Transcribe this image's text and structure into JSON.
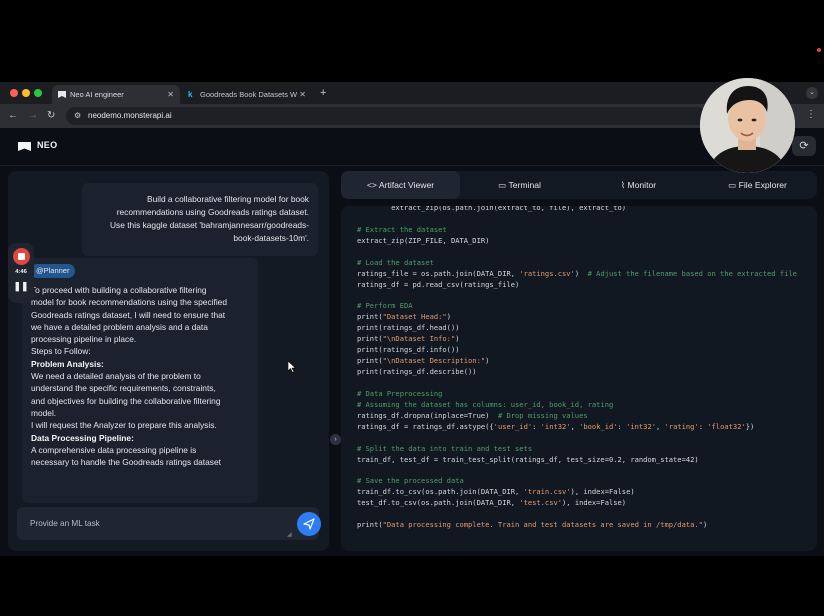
{
  "browser": {
    "tabs": [
      {
        "title": "Neo AI engineer",
        "active": true
      },
      {
        "title": "Goodreads Book Datasets W",
        "active": false
      }
    ],
    "url": "neodemo.monsterapi.ai"
  },
  "app": {
    "name": "NEO",
    "right_tabs": [
      {
        "label": "Artifact Viewer",
        "icon": "code-icon"
      },
      {
        "label": "Terminal",
        "icon": "terminal-icon"
      },
      {
        "label": "Monitor",
        "icon": "monitor-icon"
      },
      {
        "label": "File Explorer",
        "icon": "folder-icon"
      }
    ]
  },
  "recording": {
    "time": "4:46"
  },
  "chat": {
    "user_message": [
      "Build a collaborative filtering model for book",
      "recommendations using Goodreads ratings dataset.",
      "Use this kaggle dataset 'bahramjannesarr/goodreads-",
      "book-datasets-10m'."
    ],
    "agent_badge": "@Planner",
    "agent_lines": [
      {
        "text": "To proceed with building a collaborative filtering",
        "bold": false
      },
      {
        "text": "model for book recommendations using the specified",
        "bold": false
      },
      {
        "text": "Goodreads ratings dataset, I will need to ensure that",
        "bold": false
      },
      {
        "text": "we have a detailed problem analysis and a data",
        "bold": false
      },
      {
        "text": "processing pipeline in place.",
        "bold": false
      },
      {
        "text": "Steps to Follow:",
        "bold": false
      },
      {
        "text": "Problem Analysis:",
        "bold": true
      },
      {
        "text": "We need a detailed analysis of the problem to",
        "bold": false
      },
      {
        "text": "understand the specific requirements, constraints,",
        "bold": false
      },
      {
        "text": "and objectives for building the collaborative filtering",
        "bold": false
      },
      {
        "text": "model.",
        "bold": false
      },
      {
        "text": "I will request the Analyzer to prepare this analysis.",
        "bold": false
      },
      {
        "text": "Data Processing Pipeline:",
        "bold": true
      },
      {
        "text": "A comprehensive data processing pipeline is",
        "bold": false
      },
      {
        "text": "necessary to handle the Goodreads ratings dataset",
        "bold": false
      }
    ],
    "input_placeholder": "Provide an ML task"
  },
  "code_lines": [
    "        extract_zip(os.path.join(extract_to, file), extract_to)",
    "",
    "# Extract the dataset",
    "extract_zip(ZIP_FILE, DATA_DIR)",
    "",
    "# Load the dataset",
    "ratings_file = os.path.join(DATA_DIR, 'ratings.csv')  # Adjust the filename based on the extracted file",
    "ratings_df = pd.read_csv(ratings_file)",
    "",
    "# Perform EDA",
    "print(\"Dataset Head:\")",
    "print(ratings_df.head())",
    "print(\"\\nDataset Info:\")",
    "print(ratings_df.info())",
    "print(\"\\nDataset Description:\")",
    "print(ratings_df.describe())",
    "",
    "# Data Preprocessing",
    "# Assuming the dataset has columns: user_id, book_id, rating",
    "ratings_df.dropna(inplace=True)  # Drop missing values",
    "ratings_df = ratings_df.astype({'user_id': 'int32', 'book_id': 'int32', 'rating': 'float32'})",
    "",
    "# Split the data into train and test sets",
    "train_df, test_df = train_test_split(ratings_df, test_size=0.2, random_state=42)",
    "",
    "# Save the processed data",
    "train_df.to_csv(os.path.join(DATA_DIR, 'train.csv'), index=False)",
    "test_df.to_csv(os.path.join(DATA_DIR, 'test.csv'), index=False)",
    "",
    "print(\"Data processing complete. Train and test datasets are saved in /tmp/data.\")"
  ],
  "colors": {
    "accent": "#2f7df6",
    "badge": "#24558d",
    "record": "#e2463f",
    "comment": "#4f9d6a",
    "string": "#e39a6f"
  }
}
